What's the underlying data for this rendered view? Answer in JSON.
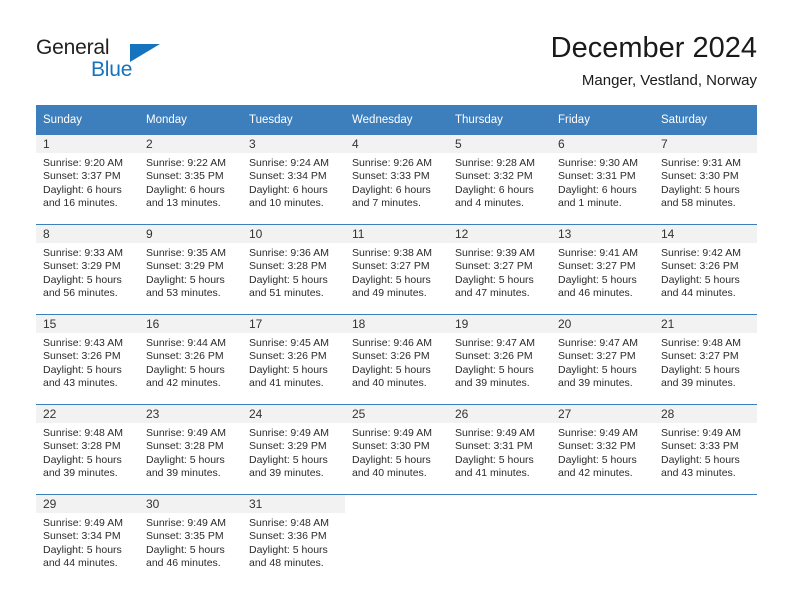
{
  "branding": {
    "word_general": "General",
    "word_blue": "Blue",
    "accent_color": "#1673bd"
  },
  "header": {
    "title": "December 2024",
    "subtitle": "Manger, Vestland, Norway"
  },
  "calendar": {
    "header_color": "#3d7ebd",
    "daynum_band_color": "#f2f2f2",
    "weekday_headers": [
      "Sunday",
      "Monday",
      "Tuesday",
      "Wednesday",
      "Thursday",
      "Friday",
      "Saturday"
    ],
    "weeks": [
      [
        {
          "day": "1",
          "sunrise": "Sunrise: 9:20 AM",
          "sunset": "Sunset: 3:37 PM",
          "daylight_line1": "Daylight: 6 hours",
          "daylight_line2": "and 16 minutes."
        },
        {
          "day": "2",
          "sunrise": "Sunrise: 9:22 AM",
          "sunset": "Sunset: 3:35 PM",
          "daylight_line1": "Daylight: 6 hours",
          "daylight_line2": "and 13 minutes."
        },
        {
          "day": "3",
          "sunrise": "Sunrise: 9:24 AM",
          "sunset": "Sunset: 3:34 PM",
          "daylight_line1": "Daylight: 6 hours",
          "daylight_line2": "and 10 minutes."
        },
        {
          "day": "4",
          "sunrise": "Sunrise: 9:26 AM",
          "sunset": "Sunset: 3:33 PM",
          "daylight_line1": "Daylight: 6 hours",
          "daylight_line2": "and 7 minutes."
        },
        {
          "day": "5",
          "sunrise": "Sunrise: 9:28 AM",
          "sunset": "Sunset: 3:32 PM",
          "daylight_line1": "Daylight: 6 hours",
          "daylight_line2": "and 4 minutes."
        },
        {
          "day": "6",
          "sunrise": "Sunrise: 9:30 AM",
          "sunset": "Sunset: 3:31 PM",
          "daylight_line1": "Daylight: 6 hours",
          "daylight_line2": "and 1 minute."
        },
        {
          "day": "7",
          "sunrise": "Sunrise: 9:31 AM",
          "sunset": "Sunset: 3:30 PM",
          "daylight_line1": "Daylight: 5 hours",
          "daylight_line2": "and 58 minutes."
        }
      ],
      [
        {
          "day": "8",
          "sunrise": "Sunrise: 9:33 AM",
          "sunset": "Sunset: 3:29 PM",
          "daylight_line1": "Daylight: 5 hours",
          "daylight_line2": "and 56 minutes."
        },
        {
          "day": "9",
          "sunrise": "Sunrise: 9:35 AM",
          "sunset": "Sunset: 3:29 PM",
          "daylight_line1": "Daylight: 5 hours",
          "daylight_line2": "and 53 minutes."
        },
        {
          "day": "10",
          "sunrise": "Sunrise: 9:36 AM",
          "sunset": "Sunset: 3:28 PM",
          "daylight_line1": "Daylight: 5 hours",
          "daylight_line2": "and 51 minutes."
        },
        {
          "day": "11",
          "sunrise": "Sunrise: 9:38 AM",
          "sunset": "Sunset: 3:27 PM",
          "daylight_line1": "Daylight: 5 hours",
          "daylight_line2": "and 49 minutes."
        },
        {
          "day": "12",
          "sunrise": "Sunrise: 9:39 AM",
          "sunset": "Sunset: 3:27 PM",
          "daylight_line1": "Daylight: 5 hours",
          "daylight_line2": "and 47 minutes."
        },
        {
          "day": "13",
          "sunrise": "Sunrise: 9:41 AM",
          "sunset": "Sunset: 3:27 PM",
          "daylight_line1": "Daylight: 5 hours",
          "daylight_line2": "and 46 minutes."
        },
        {
          "day": "14",
          "sunrise": "Sunrise: 9:42 AM",
          "sunset": "Sunset: 3:26 PM",
          "daylight_line1": "Daylight: 5 hours",
          "daylight_line2": "and 44 minutes."
        }
      ],
      [
        {
          "day": "15",
          "sunrise": "Sunrise: 9:43 AM",
          "sunset": "Sunset: 3:26 PM",
          "daylight_line1": "Daylight: 5 hours",
          "daylight_line2": "and 43 minutes."
        },
        {
          "day": "16",
          "sunrise": "Sunrise: 9:44 AM",
          "sunset": "Sunset: 3:26 PM",
          "daylight_line1": "Daylight: 5 hours",
          "daylight_line2": "and 42 minutes."
        },
        {
          "day": "17",
          "sunrise": "Sunrise: 9:45 AM",
          "sunset": "Sunset: 3:26 PM",
          "daylight_line1": "Daylight: 5 hours",
          "daylight_line2": "and 41 minutes."
        },
        {
          "day": "18",
          "sunrise": "Sunrise: 9:46 AM",
          "sunset": "Sunset: 3:26 PM",
          "daylight_line1": "Daylight: 5 hours",
          "daylight_line2": "and 40 minutes."
        },
        {
          "day": "19",
          "sunrise": "Sunrise: 9:47 AM",
          "sunset": "Sunset: 3:26 PM",
          "daylight_line1": "Daylight: 5 hours",
          "daylight_line2": "and 39 minutes."
        },
        {
          "day": "20",
          "sunrise": "Sunrise: 9:47 AM",
          "sunset": "Sunset: 3:27 PM",
          "daylight_line1": "Daylight: 5 hours",
          "daylight_line2": "and 39 minutes."
        },
        {
          "day": "21",
          "sunrise": "Sunrise: 9:48 AM",
          "sunset": "Sunset: 3:27 PM",
          "daylight_line1": "Daylight: 5 hours",
          "daylight_line2": "and 39 minutes."
        }
      ],
      [
        {
          "day": "22",
          "sunrise": "Sunrise: 9:48 AM",
          "sunset": "Sunset: 3:28 PM",
          "daylight_line1": "Daylight: 5 hours",
          "daylight_line2": "and 39 minutes."
        },
        {
          "day": "23",
          "sunrise": "Sunrise: 9:49 AM",
          "sunset": "Sunset: 3:28 PM",
          "daylight_line1": "Daylight: 5 hours",
          "daylight_line2": "and 39 minutes."
        },
        {
          "day": "24",
          "sunrise": "Sunrise: 9:49 AM",
          "sunset": "Sunset: 3:29 PM",
          "daylight_line1": "Daylight: 5 hours",
          "daylight_line2": "and 39 minutes."
        },
        {
          "day": "25",
          "sunrise": "Sunrise: 9:49 AM",
          "sunset": "Sunset: 3:30 PM",
          "daylight_line1": "Daylight: 5 hours",
          "daylight_line2": "and 40 minutes."
        },
        {
          "day": "26",
          "sunrise": "Sunrise: 9:49 AM",
          "sunset": "Sunset: 3:31 PM",
          "daylight_line1": "Daylight: 5 hours",
          "daylight_line2": "and 41 minutes."
        },
        {
          "day": "27",
          "sunrise": "Sunrise: 9:49 AM",
          "sunset": "Sunset: 3:32 PM",
          "daylight_line1": "Daylight: 5 hours",
          "daylight_line2": "and 42 minutes."
        },
        {
          "day": "28",
          "sunrise": "Sunrise: 9:49 AM",
          "sunset": "Sunset: 3:33 PM",
          "daylight_line1": "Daylight: 5 hours",
          "daylight_line2": "and 43 minutes."
        }
      ],
      [
        {
          "day": "29",
          "sunrise": "Sunrise: 9:49 AM",
          "sunset": "Sunset: 3:34 PM",
          "daylight_line1": "Daylight: 5 hours",
          "daylight_line2": "and 44 minutes."
        },
        {
          "day": "30",
          "sunrise": "Sunrise: 9:49 AM",
          "sunset": "Sunset: 3:35 PM",
          "daylight_line1": "Daylight: 5 hours",
          "daylight_line2": "and 46 minutes."
        },
        {
          "day": "31",
          "sunrise": "Sunrise: 9:48 AM",
          "sunset": "Sunset: 3:36 PM",
          "daylight_line1": "Daylight: 5 hours",
          "daylight_line2": "and 48 minutes."
        },
        {
          "day": "",
          "sunrise": "",
          "sunset": "",
          "daylight_line1": "",
          "daylight_line2": ""
        },
        {
          "day": "",
          "sunrise": "",
          "sunset": "",
          "daylight_line1": "",
          "daylight_line2": ""
        },
        {
          "day": "",
          "sunrise": "",
          "sunset": "",
          "daylight_line1": "",
          "daylight_line2": ""
        },
        {
          "day": "",
          "sunrise": "",
          "sunset": "",
          "daylight_line1": "",
          "daylight_line2": ""
        }
      ]
    ]
  }
}
